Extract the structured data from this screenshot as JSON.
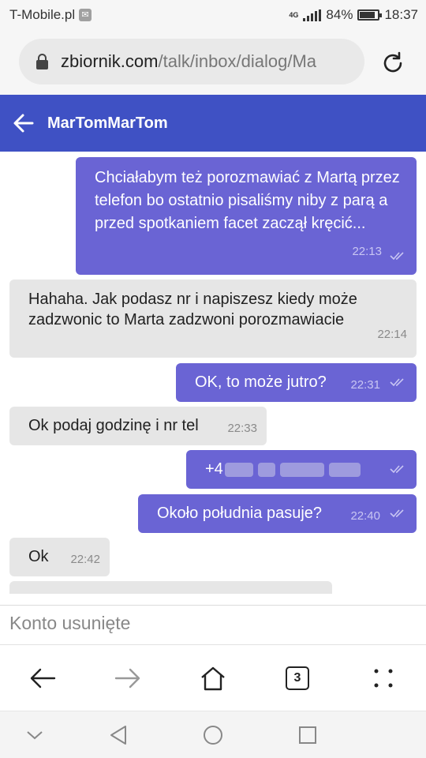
{
  "status_bar": {
    "carrier": "T-Mobile.pl",
    "network": "4G",
    "battery": "84%",
    "battery_level": 0.84,
    "time": "18:37"
  },
  "browser": {
    "url_host": "zbiornik.com",
    "url_path": "/talk/inbox/dialog/Ma",
    "tabs_count": "3"
  },
  "header": {
    "title": "MarTomMarTom"
  },
  "messages": [
    {
      "direction": "out",
      "text": "Chciałabym też porozmawiać z Martą przez telefon bo ostatnio pisaliśmy niby z parą a przed spotkaniem facet zaczął kręcić...",
      "time": "22:13"
    },
    {
      "direction": "in",
      "text": "Hahaha. Jak podasz nr i napiszesz kiedy może zadzwonic to Marta zadzwoni porozmawiacie",
      "time": "22:14"
    },
    {
      "direction": "out",
      "text": "OK, to może jutro?",
      "time": "22:31"
    },
    {
      "direction": "in",
      "text": "Ok podaj godzinę i nr tel",
      "time": "22:33"
    },
    {
      "direction": "out",
      "text": "+4",
      "time": "",
      "redacted": true
    },
    {
      "direction": "out",
      "text": "Około południa pasuje?",
      "time": "22:40"
    },
    {
      "direction": "in",
      "text": "Ok",
      "time": "22:42"
    }
  ],
  "footer": {
    "notice": "Konto usunięte"
  },
  "colors": {
    "header": "#3f51c4",
    "outgoing_bubble": "#6a64d4",
    "incoming_bubble": "#e6e6e6"
  }
}
